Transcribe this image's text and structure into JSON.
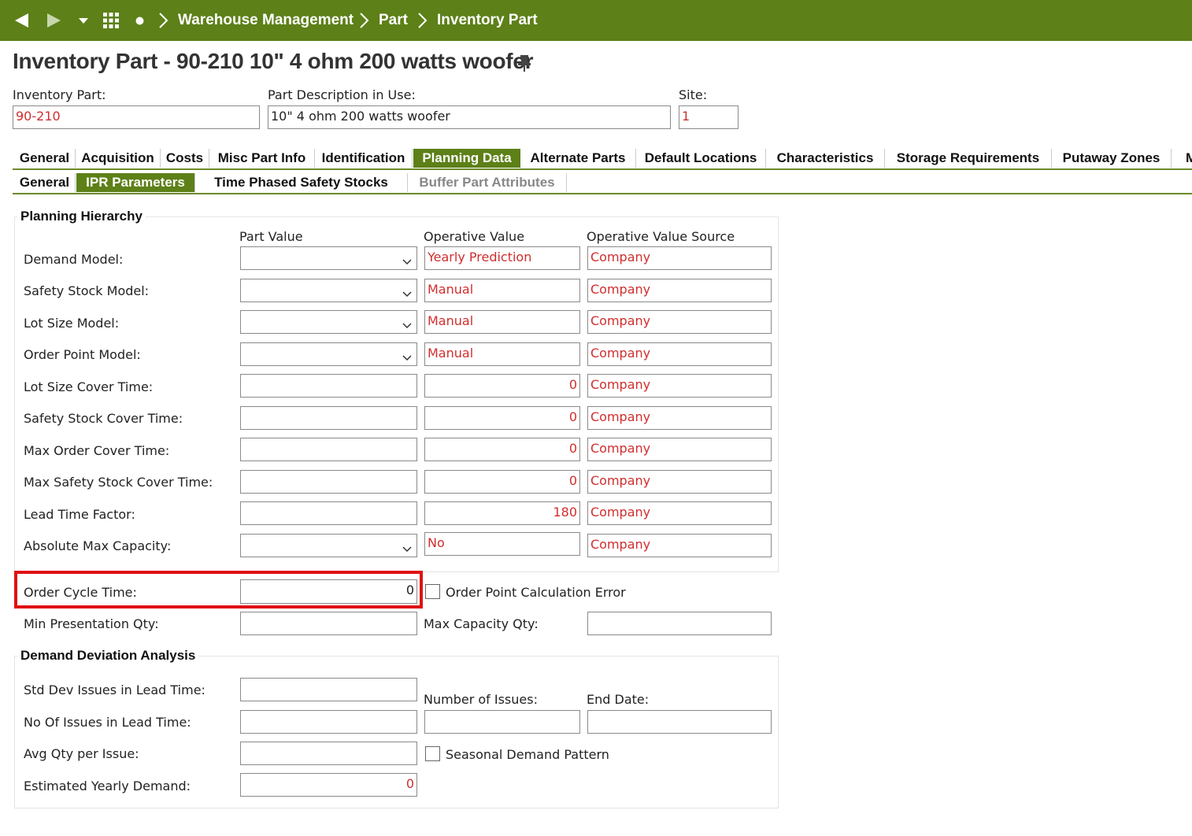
{
  "nav": {
    "breadcrumbs": [
      "Warehouse Management",
      "Part",
      "Inventory Part"
    ]
  },
  "header": {
    "title": "Inventory Part - 90-210 10\" 4 ohm 200 watts woofer"
  },
  "fields": {
    "inventory_part_label": "Inventory Part:",
    "inventory_part_value": "90-210",
    "description_label": "Part Description in Use:",
    "description_value": "10\" 4 ohm 200 watts woofer",
    "site_label": "Site:",
    "site_value": "1"
  },
  "tabs": [
    "General",
    "Acquisition",
    "Costs",
    "Misc Part Info",
    "Identification",
    "Planning Data",
    "Alternate Parts",
    "Default Locations",
    "Characteristics",
    "Storage Requirements",
    "Putaway Zones",
    "M"
  ],
  "subtabs": [
    "General",
    "IPR Parameters",
    "Time Phased Safety Stocks",
    "Buffer Part Attributes"
  ],
  "planning": {
    "group_title": "Planning Hierarchy",
    "col_part_value": "Part Value",
    "col_operative_value": "Operative Value",
    "col_operative_source": "Operative Value Source",
    "rows": [
      {
        "label": "Demand Model:",
        "part": "",
        "operative": "Yearly Prediction",
        "source": "Company"
      },
      {
        "label": "Safety Stock Model:",
        "part": "",
        "operative": "Manual",
        "source": "Company"
      },
      {
        "label": "Lot Size Model:",
        "part": "",
        "operative": "Manual",
        "source": "Company"
      },
      {
        "label": "Order Point Model:",
        "part": "",
        "operative": "Manual",
        "source": "Company"
      },
      {
        "label": "Lot Size Cover Time:",
        "part": "",
        "operative": "0",
        "source": "Company"
      },
      {
        "label": "Safety Stock Cover Time:",
        "part": "",
        "operative": "0",
        "source": "Company"
      },
      {
        "label": "Max Order Cover Time:",
        "part": "",
        "operative": "0",
        "source": "Company"
      },
      {
        "label": "Max Safety Stock Cover Time:",
        "part": "",
        "operative": "0",
        "source": "Company"
      },
      {
        "label": "Lead Time Factor:",
        "part": "",
        "operative": "180",
        "source": "Company"
      },
      {
        "label": "Absolute Max Capacity:",
        "part": "",
        "operative": "No",
        "source": "Company"
      }
    ]
  },
  "extra": {
    "order_cycle_label": "Order Cycle Time:",
    "order_cycle_value": "0",
    "order_point_error_label": "Order Point Calculation Error",
    "min_presentation_label": "Min Presentation Qty:",
    "min_presentation_value": "",
    "max_capacity_label": "Max Capacity Qty:",
    "max_capacity_value": ""
  },
  "deviation": {
    "group_title": "Demand Deviation Analysis",
    "std_dev_label": "Std Dev Issues in Lead Time:",
    "std_dev_value": "",
    "number_of_issues_label": "Number of Issues:",
    "number_of_issues_value": "",
    "end_date_label": "End Date:",
    "end_date_value": "",
    "no_of_issues_label": "No Of Issues in Lead Time:",
    "no_of_issues_value": "",
    "avg_qty_label": "Avg Qty per Issue:",
    "avg_qty_value": "",
    "seasonal_label": "Seasonal Demand Pattern",
    "yearly_demand_label": "Estimated Yearly Demand:",
    "yearly_demand_value": "0"
  },
  "colors": {
    "brand_green": "#5d8018",
    "operative_red": "#d12e2e",
    "highlight_red": "#e01010"
  },
  "icons": [
    "back-arrow-icon",
    "forward-arrow-icon",
    "dropdown-caret-icon",
    "app-grid-icon",
    "dot-icon",
    "chevron-right-icon",
    "pin-icon",
    "select-caret-icon"
  ]
}
